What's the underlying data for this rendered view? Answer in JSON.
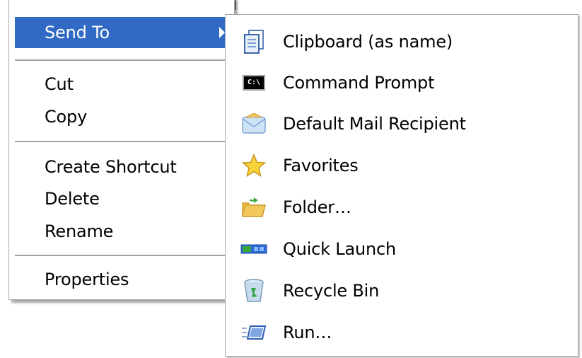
{
  "context_menu": {
    "items": [
      {
        "label": "Send To"
      },
      {
        "label": "Cut"
      },
      {
        "label": "Copy"
      },
      {
        "label": "Create Shortcut"
      },
      {
        "label": "Delete"
      },
      {
        "label": "Rename"
      },
      {
        "label": "Properties"
      }
    ],
    "highlight_color": "#316ac5"
  },
  "send_to_menu": {
    "items": [
      {
        "label": "Clipboard (as name)",
        "icon": "clipboard-document-icon"
      },
      {
        "label": "Command Prompt",
        "icon": "command-prompt-icon"
      },
      {
        "label": "Default Mail Recipient",
        "icon": "mail-envelope-icon"
      },
      {
        "label": "Favorites",
        "icon": "star-icon"
      },
      {
        "label": "Folder…",
        "icon": "folder-icon"
      },
      {
        "label": "Quick Launch",
        "icon": "quick-launch-icon"
      },
      {
        "label": "Recycle Bin",
        "icon": "recycle-bin-icon"
      },
      {
        "label": "Run…",
        "icon": "run-icon"
      }
    ],
    "command_prompt_icon_text": "C:\\"
  }
}
